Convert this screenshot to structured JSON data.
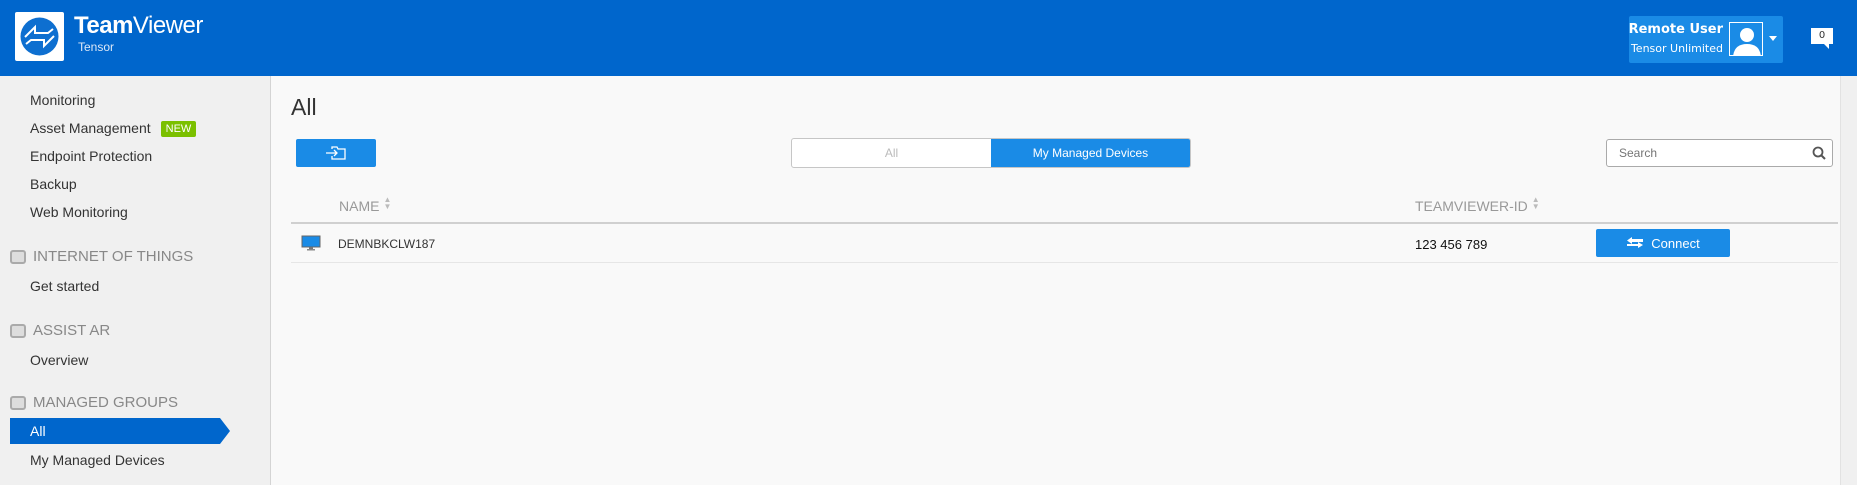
{
  "header": {
    "brand_bold": "Team",
    "brand_light": "Viewer",
    "product": "Tensor",
    "user_name": "Remote User",
    "user_org": "Tensor Unlimited",
    "notifications": "0"
  },
  "sidebar": {
    "items": [
      {
        "label": "Monitoring"
      },
      {
        "label": "Asset Management",
        "badge": "NEW"
      },
      {
        "label": "Endpoint Protection"
      },
      {
        "label": "Backup"
      },
      {
        "label": "Web Monitoring"
      }
    ],
    "iot": {
      "title": "INTERNET OF THINGS",
      "items": [
        "Get started"
      ]
    },
    "assist": {
      "title": "ASSIST AR",
      "items": [
        "Overview"
      ]
    },
    "groups": {
      "title": "MANAGED GROUPS",
      "items": [
        "All",
        "My Managed Devices"
      ],
      "selected": "All"
    }
  },
  "main": {
    "title": "All",
    "toggle": {
      "options": [
        "All",
        "My Managed Devices"
      ],
      "active": "My Managed Devices"
    },
    "search_placeholder": "Search",
    "columns": [
      "NAME",
      "TEAMVIEWER-ID"
    ],
    "rows": [
      {
        "name": "DEMNBKCLW187",
        "id": "123 456 789",
        "action": "Connect"
      }
    ]
  },
  "colors": {
    "brand": "#0066cc",
    "accent": "#1a8be6",
    "badge": "#7bc000"
  }
}
